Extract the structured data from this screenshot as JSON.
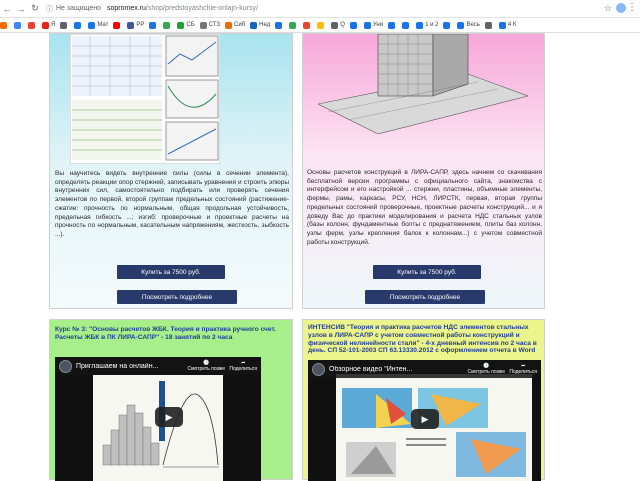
{
  "browser": {
    "secure_label": "Не защищено",
    "url_host": "sopromex.ru",
    "url_path": "/shop/predstoyashchie-onlajn-kursy/",
    "bookmarks": [
      {
        "label": "",
        "color": "#ff6a00"
      },
      {
        "label": "",
        "color": "#4285f4"
      },
      {
        "label": "",
        "color": "#ea4335"
      },
      {
        "label": "Я",
        "color": "#e62117"
      },
      {
        "label": "",
        "color": "#5f6368"
      },
      {
        "label": "",
        "color": "#1a73e8"
      },
      {
        "label": "Мат",
        "color": "#1a73e8"
      },
      {
        "label": "",
        "color": "#ff0000"
      },
      {
        "label": "РР",
        "color": "#3b5998"
      },
      {
        "label": "",
        "color": "#1a73e8"
      },
      {
        "label": "",
        "color": "#34a853"
      },
      {
        "label": "СБ",
        "color": "#21a038"
      },
      {
        "label": "СТЗ",
        "color": "#777777"
      },
      {
        "label": "Сиб",
        "color": "#ef6c00"
      },
      {
        "label": "Нед",
        "color": "#1565c0"
      },
      {
        "label": "",
        "color": "#1a73e8"
      },
      {
        "label": "",
        "color": "#34a853"
      },
      {
        "label": "",
        "color": "#ea4335"
      },
      {
        "label": "",
        "color": "#fbbc05"
      },
      {
        "label": "Q",
        "color": "#5f6368"
      },
      {
        "label": "",
        "color": "#1a73e8"
      },
      {
        "label": "Уни",
        "color": "#1a73e8"
      },
      {
        "label": "",
        "color": "#1a73e8"
      },
      {
        "label": "",
        "color": "#1a73e8"
      },
      {
        "label": "1 и 2",
        "color": "#1a73e8"
      },
      {
        "label": "",
        "color": "#1a73e8"
      },
      {
        "label": "Весь",
        "color": "#1a73e8"
      },
      {
        "label": "",
        "color": "#5f6368"
      },
      {
        "label": "4 К",
        "color": "#1a73e8"
      }
    ]
  },
  "cards": [
    {
      "description": "Вы научитесь видеть внутренние силы (силы в сечении элемента), определять реакции опор стержней, записывать уравнения и строить эпюры внутренних сил, самостоятельно подбирать или проверять сечения элементов по первой, второй группам предельных состояний (растяжение-сжатие: прочность по нормальным, общая продольная устойчивость, предельная гибкость ...; изгиб: проверочные и проектные расчеты на прочность по нормальным, касательным напряжениям, жесткость, зыбкость ...).",
      "buy_label": "Купить за 7500 руб.",
      "more_label": "Посмотреть подробнее"
    },
    {
      "description": "Основы расчетов конструкций в ЛИРА-САПР, здесь начнем со скачивания бесплатной версии программы с официального сайта, знакомства с интерфейсом и его настройкой ... стержни, пластины, объемные элементы, фермы, рамы, каркасы, РСУ, НСН, ЛИРСТК, первая, вторая группы предельных состояний проверочные, проектные расчеты конструкций... и я доведу Вас до практики моделирования и расчета НДС стальных узлов (базы колонн, фундаментные болты с преднатяжением, плиты баз колонн, узлы ферм, узлы крепления балок к колоннам...) с учетом совместной работы конструкций.",
      "buy_label": "Купить за 7500 руб.",
      "more_label": "Посмотреть подробнее"
    },
    {
      "title": "Курс № 3: \"Основы расчетов ЖБК. Теория и практика ручного счет. Расчеты ЖБК в ПК ЛИРА-САПР\" - 18 занятий по 2 часа",
      "video_title": "Приглашаем на онлайн...",
      "video_later": "Смотреть позже",
      "video_share": "Поделиться"
    },
    {
      "title": "ИНТЕНСИВ \"Теория и практика расчетов НДС элементов стальных узлов в ЛИРА-САПР с учетом совместной работы конструкций и физической нелинейности стали\" - 4-х дневный интенсив по 2 часа в день. СП 52-101-2003 СП 63.13330.2012 с оформлением отчета в Word",
      "video_title": "Обзорное видео \"Интен...",
      "video_later": "Смотреть позже",
      "video_share": "Поделиться"
    }
  ]
}
